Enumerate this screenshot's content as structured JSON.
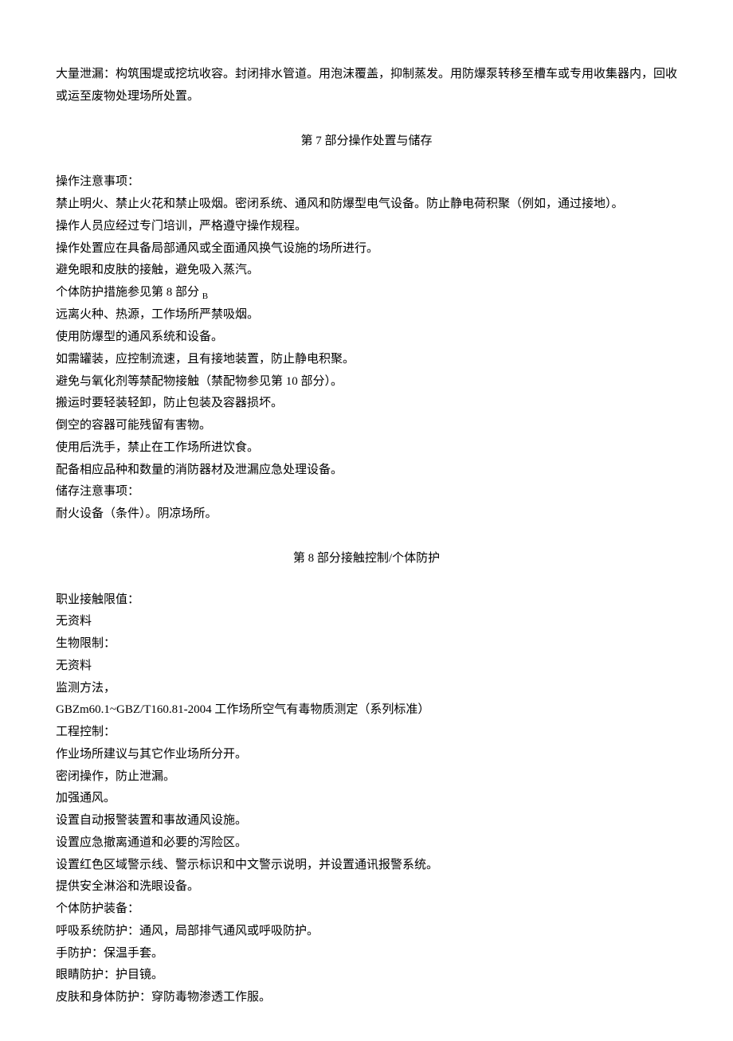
{
  "intro": "大量泄漏：构筑围堤或挖坑收容。封闭排水管道。用泡沫覆盖，抑制蒸发。用防爆泵转移至槽车或专用收集器内，回收或运至废物处理场所处置。",
  "section7": {
    "heading": "第 7 部分操作处置与储存",
    "lines": [
      "操作注意事项：",
      "禁止明火、禁止火花和禁止吸烟。密闭系统、通风和防爆型电气设备。防止静电荷积聚（例如，通过接地）。",
      "操作人员应经过专门培训，严格遵守操作规程。",
      "操作处置应在具备局部通风或全面通风换气设施的场所进行。",
      "避免眼和皮肤的接触，避免吸入蒸汽。"
    ],
    "line_with_sub_prefix": "个体防护措施参见第 8 部分 ",
    "line_with_sub_sub": "B",
    "lines2": [
      "远离火种、热源，工作场所严禁吸烟。",
      "使用防爆型的通风系统和设备。",
      "如需罐装，应控制流速，且有接地装置，防止静电积聚。",
      "避免与氧化剂等禁配物接触（禁配物参见第 10 部分）。",
      "搬运时要轻装轻卸，防止包装及容器损坏。",
      "倒空的容器可能残留有害物。",
      "使用后洗手，禁止在工作场所进饮食。",
      "配备相应品种和数量的消防器材及泄漏应急处理设备。",
      "储存注意事项：",
      "耐火设备（条件）。阴凉场所。"
    ]
  },
  "section8": {
    "heading": "第 8 部分接触控制/个体防护",
    "lines": [
      "职业接触限值：",
      "无资料",
      "生物限制：",
      "无资料",
      "监测方法，",
      "GBZm60.1~GBZ/T160.81-2004 工作场所空气有毒物质测定（系列标准）",
      "工程控制：",
      "作业场所建议与其它作业场所分开。",
      "密闭操作，防止泄漏。",
      "加强通风。",
      "设置自动报警装置和事故通风设施。",
      "设置应急撤离通道和必要的泻险区。",
      "设置红色区域警示线、警示标识和中文警示说明，并设置通讯报警系统。",
      "提供安全淋浴和洗眼设备。",
      "个体防护装备：",
      "呼吸系统防护：通风，局部排气通风或呼吸防护。",
      "手防护：保温手套。",
      "眼睛防护：护目镜。",
      "皮肤和身体防护：穿防毒物渗透工作服。"
    ]
  }
}
